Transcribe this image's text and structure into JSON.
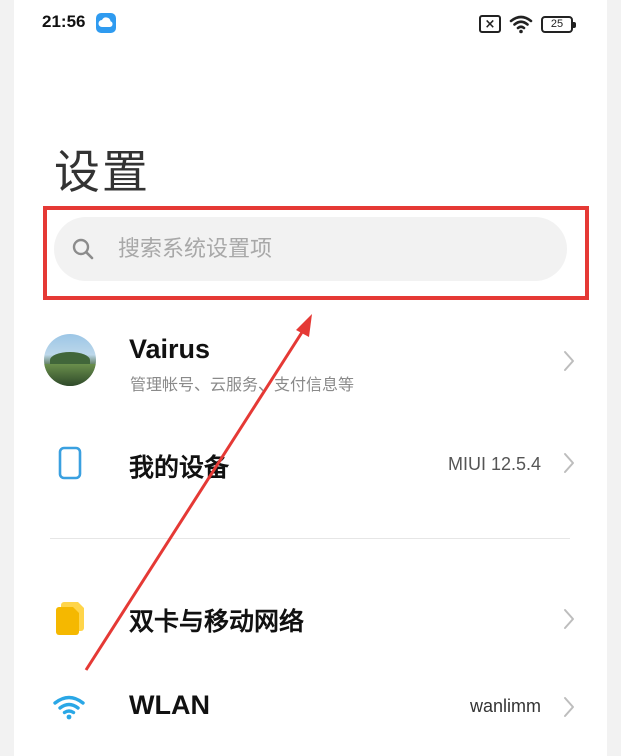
{
  "status_bar": {
    "time": "21:56",
    "battery": "25",
    "sim_off_glyph": "×",
    "icons": [
      "cloud-icon",
      "sim-off-icon",
      "wifi-icon",
      "battery-icon"
    ]
  },
  "page": {
    "title": "设置"
  },
  "search": {
    "placeholder": "搜索系统设置项",
    "value": ""
  },
  "rows": [
    {
      "title": "Vairus",
      "subtitle": "管理帐号、云服务、支付信息等",
      "value": "",
      "icon": "avatar"
    },
    {
      "title": "我的设备",
      "subtitle": "",
      "value": "MIUI 12.5.4",
      "icon": "phone-icon"
    },
    {
      "title": "双卡与移动网络",
      "subtitle": "",
      "value": "",
      "icon": "sim-cards-icon"
    },
    {
      "title": "WLAN",
      "subtitle": "",
      "value": "wanlimm",
      "icon": "wifi-icon"
    }
  ],
  "colors": {
    "highlight": "#e53935",
    "phone_icon": "#3aa0e0",
    "sim_icon": "#f5b800",
    "wifi_icon": "#2aa7e6",
    "cloud": "#2f9bf0"
  }
}
